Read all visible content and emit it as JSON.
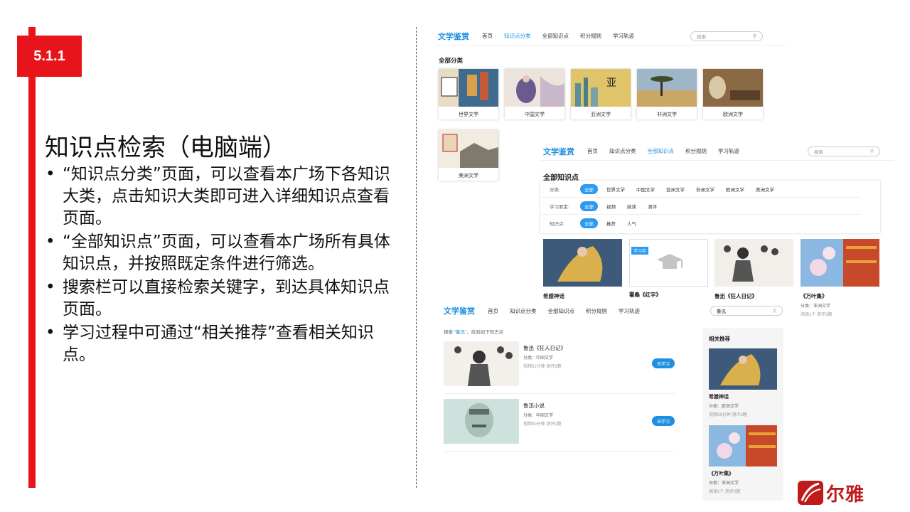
{
  "slide": {
    "section": "5.1.1",
    "title": "知识点检索（电脑端）",
    "bullets": [
      "“知识点分类”页面，可以查看本广场下各知识大类，点击知识大类即可进入详细知识点查看页面。",
      "“全部知识点”页面，可以查看本广场所有具体知识点，并按照既定条件进行筛选。",
      "搜索栏可以直接检索关键字，到达具体知识点页面。",
      "学习过程中可通过“相关推荐”查看相关知识点。"
    ]
  },
  "nav": {
    "brand": "文学鉴赏",
    "items": [
      "首页",
      "知识点分类",
      "全部知识点",
      "积分规则",
      "学习轨迹"
    ],
    "search_placeholder": "搜索",
    "search_query": "鲁迅"
  },
  "categories_page": {
    "title": "全部分类",
    "categories": [
      "世界文学",
      "中国文学",
      "亚洲文学",
      "非洲文学",
      "欧洲文学",
      "美洲文学"
    ]
  },
  "all_points_page": {
    "title": "全部知识点",
    "filters": [
      {
        "label": "分类:",
        "options": [
          "全部",
          "世界文学",
          "中国文学",
          "亚洲文学",
          "非洲文学",
          "欧洲文学",
          "美洲文学"
        ]
      },
      {
        "label": "学习要素:",
        "options": [
          "全部",
          "视频",
          "阅读",
          "测评"
        ]
      },
      {
        "label": "知识点:",
        "options": [
          "全部",
          "推荐",
          "人气"
        ]
      }
    ],
    "cards": [
      {
        "title": "希腊神话",
        "category": "",
        "stats": ""
      },
      {
        "title": "霍桑《红字》",
        "category": "",
        "stats": "",
        "tag": "学习中"
      },
      {
        "title": "鲁迅《狂人日记》",
        "category": "",
        "stats": ""
      },
      {
        "title": "《万叶集》",
        "category": "分类：亚洲文学",
        "stats": "阅读1个 测评2题"
      }
    ]
  },
  "search_page": {
    "hint_prefix": "搜索 “",
    "hint_keyword": "鲁迅",
    "hint_suffix": "”，找到如下知识点",
    "results": [
      {
        "title": "鲁迅《狂人日记》",
        "category": "分类：中国文学",
        "stats": "视频51分钟 测评2题",
        "button": "去学习"
      },
      {
        "title": "鲁迅小说",
        "category": "分类：中国文学",
        "stats": "视频30分钟 测评2题",
        "button": "去学习"
      }
    ],
    "recommend": {
      "title": "相关推荐",
      "items": [
        {
          "name": "希腊神话",
          "category": "分类：欧洲文学",
          "stats": "视频59分钟 测评2题"
        },
        {
          "name": "《万叶集》",
          "category": "分类：亚洲文学",
          "stats": "阅读1个 测评2题"
        }
      ]
    }
  },
  "logo": {
    "text": "尔雅"
  },
  "colors": {
    "accent_red": "#e8141b",
    "brand_blue": "#1e8fe1",
    "button_blue": "#2b9af3"
  }
}
